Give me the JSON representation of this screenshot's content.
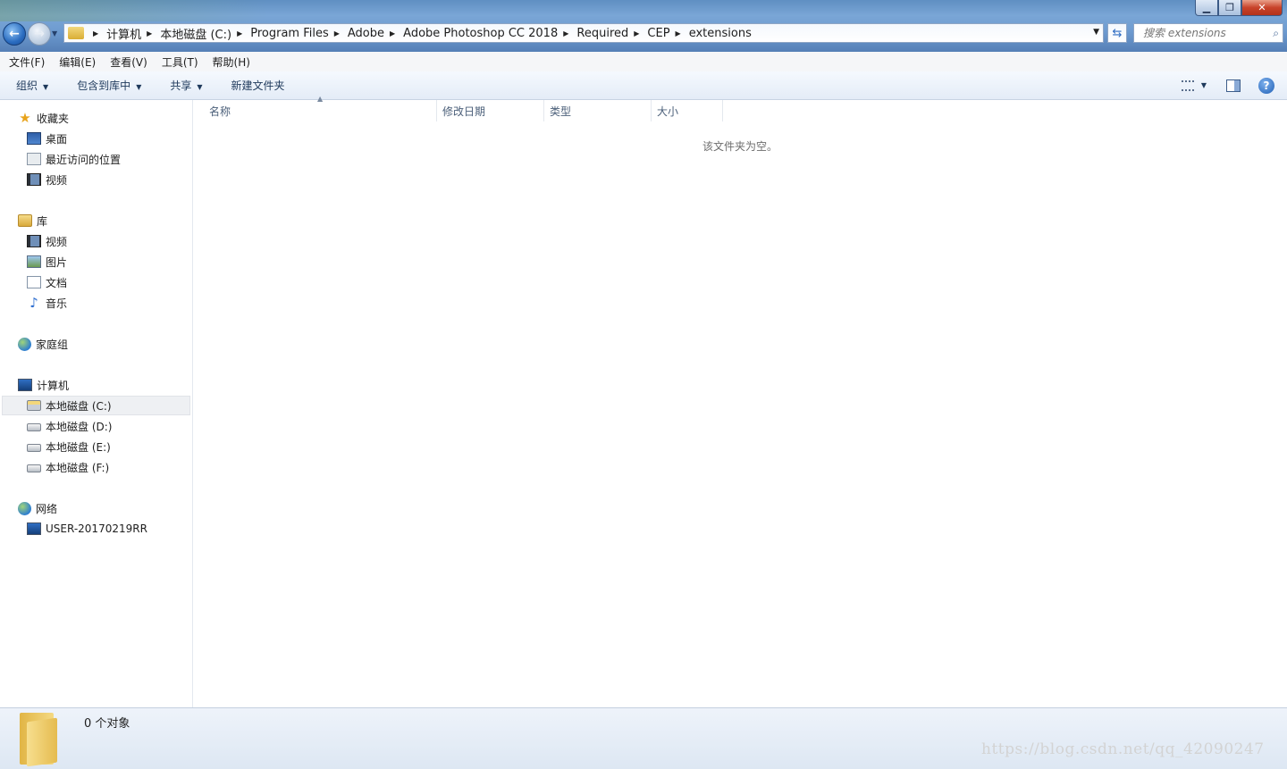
{
  "window": {
    "controls": {
      "minimize": "▁",
      "maximize": "❐",
      "close": "✕"
    }
  },
  "navigation": {
    "back_glyph": "←",
    "forward_glyph": "→"
  },
  "address": {
    "breadcrumbs": [
      "计算机",
      "本地磁盘 (C:)",
      "Program Files",
      "Adobe",
      "Adobe Photoshop CC 2018",
      "Required",
      "CEP",
      "extensions"
    ]
  },
  "search": {
    "placeholder": "搜索 extensions"
  },
  "menu": [
    "文件(F)",
    "编辑(E)",
    "查看(V)",
    "工具(T)",
    "帮助(H)"
  ],
  "toolbar": {
    "organize": "组织",
    "include_in_library": "包含到库中",
    "share": "共享",
    "new_folder": "新建文件夹",
    "help_glyph": "?"
  },
  "sidebar": {
    "favorites": {
      "label": "收藏夹",
      "items": [
        "桌面",
        "最近访问的位置",
        "视频"
      ]
    },
    "libraries": {
      "label": "库",
      "items": [
        "视频",
        "图片",
        "文档",
        "音乐"
      ]
    },
    "homegroup": {
      "label": "家庭组"
    },
    "computer": {
      "label": "计算机",
      "items": [
        "本地磁盘 (C:)",
        "本地磁盘 (D:)",
        "本地磁盘 (E:)",
        "本地磁盘 (F:)"
      ],
      "selected": "本地磁盘 (C:)"
    },
    "network": {
      "label": "网络",
      "items": [
        "USER-20170219RR"
      ]
    }
  },
  "columns": [
    "名称",
    "修改日期",
    "类型",
    "大小"
  ],
  "empty_message": "该文件夹为空。",
  "status": {
    "count_text": "0 个对象"
  },
  "watermark": "https://blog.csdn.net/qq_42090247"
}
